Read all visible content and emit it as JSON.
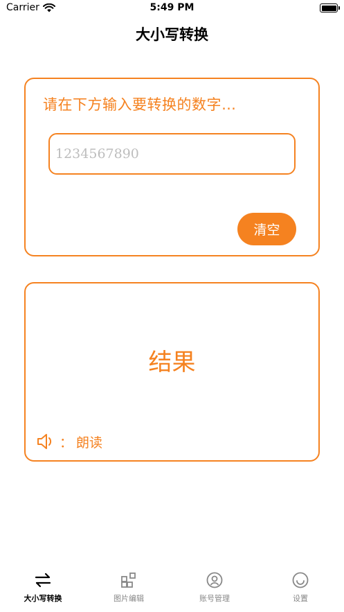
{
  "status_bar": {
    "carrier": "Carrier",
    "time": "5:49 PM"
  },
  "nav": {
    "title": "大小写转换"
  },
  "input_card": {
    "prompt": "请在下方输入要转换的数字…",
    "input_placeholder": "1234567890",
    "input_value": "",
    "clear_label": "清空"
  },
  "result_card": {
    "result_text": "结果",
    "read_separator": "：",
    "read_label": "朗读"
  },
  "tab_bar": {
    "tabs": [
      {
        "label": "大小写转换",
        "icon": "swap-arrows-icon",
        "active": true
      },
      {
        "label": "图片编辑",
        "icon": "grid-edit-icon",
        "active": false
      },
      {
        "label": "账号管理",
        "icon": "account-icon",
        "active": false
      },
      {
        "label": "设置",
        "icon": "smile-icon",
        "active": false
      }
    ]
  },
  "colors": {
    "accent": "#F58220",
    "placeholder": "#bdbdbd",
    "inactive_tab": "#888888"
  }
}
